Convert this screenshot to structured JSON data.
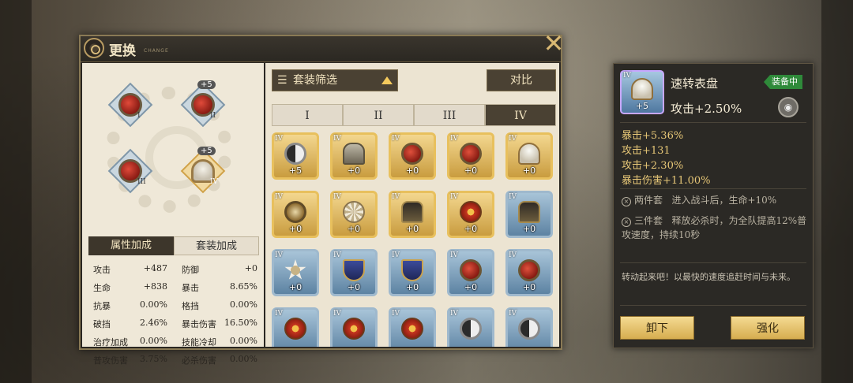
{
  "panel": {
    "title": "更换",
    "subtitle": "CHANGE",
    "close_label": "✕"
  },
  "equipped_slots": [
    {
      "roman": "I",
      "plus": "",
      "kind": "red"
    },
    {
      "roman": "II",
      "plus": "+5",
      "kind": "red"
    },
    {
      "roman": "III",
      "plus": "",
      "kind": "red"
    },
    {
      "roman": "IV",
      "plus": "+5",
      "kind": "gauge"
    }
  ],
  "stat_tabs": {
    "active": "属性加成",
    "inactive": "套装加成"
  },
  "stats": [
    {
      "k1": "攻击",
      "v1": "+487",
      "k2": "防御",
      "v2": "+0"
    },
    {
      "k1": "生命",
      "v1": "+838",
      "k2": "暴击",
      "v2": "8.65%"
    },
    {
      "k1": "抗暴",
      "v1": "0.00%",
      "k2": "格挡",
      "v2": "0.00%"
    },
    {
      "k1": "破挡",
      "v1": "2.46%",
      "k2": "暴击伤害",
      "v2": "16.50%"
    },
    {
      "k1": "治疗加成",
      "v1": "0.00%",
      "k2": "技能冷却",
      "v2": "0.00%"
    },
    {
      "k1": "普攻伤害",
      "v1": "3.75%",
      "k2": "必杀伤害",
      "v2": "0.00%"
    }
  ],
  "toolbar": {
    "filter_icon": "☰",
    "filter_label": "套装筛选",
    "compare_label": "对比"
  },
  "slot_tabs": [
    "I",
    "II",
    "III",
    "IV"
  ],
  "slot_tab_active": "IV",
  "items": [
    {
      "rarity": "gold",
      "roman": "IV",
      "level": "+5",
      "icon": "yin"
    },
    {
      "rarity": "gold",
      "roman": "IV",
      "level": "+0",
      "icon": "helm"
    },
    {
      "rarity": "gold",
      "roman": "IV",
      "level": "+0",
      "icon": "red"
    },
    {
      "rarity": "gold",
      "roman": "IV",
      "level": "+0",
      "icon": "red"
    },
    {
      "rarity": "gold",
      "roman": "IV",
      "level": "+0",
      "icon": "gauge"
    },
    {
      "rarity": "gold",
      "roman": "IV",
      "level": "+0",
      "icon": "watch"
    },
    {
      "rarity": "gold",
      "roman": "IV",
      "level": "+0",
      "icon": "shell"
    },
    {
      "rarity": "gold",
      "roman": "IV",
      "level": "+0",
      "icon": "anubis"
    },
    {
      "rarity": "gold",
      "roman": "IV",
      "level": "+0",
      "icon": "flower"
    },
    {
      "rarity": "blue",
      "roman": "IV",
      "level": "+0",
      "icon": "anubis"
    },
    {
      "rarity": "blue",
      "roman": "IV",
      "level": "+0",
      "icon": "star"
    },
    {
      "rarity": "blue",
      "roman": "IV",
      "level": "+0",
      "icon": "shield"
    },
    {
      "rarity": "blue",
      "roman": "IV",
      "level": "+0",
      "icon": "shield"
    },
    {
      "rarity": "blue",
      "roman": "IV",
      "level": "+0",
      "icon": "red"
    },
    {
      "rarity": "blue",
      "roman": "IV",
      "level": "+0",
      "icon": "red"
    },
    {
      "rarity": "blue",
      "roman": "IV",
      "level": "",
      "icon": "flower"
    },
    {
      "rarity": "blue",
      "roman": "IV",
      "level": "",
      "icon": "flower"
    },
    {
      "rarity": "blue",
      "roman": "IV",
      "level": "",
      "icon": "flower"
    },
    {
      "rarity": "blue",
      "roman": "IV",
      "level": "",
      "icon": "yin"
    },
    {
      "rarity": "blue",
      "roman": "IV",
      "level": "",
      "icon": "yin"
    }
  ],
  "detail": {
    "roman": "IV",
    "level": "+5",
    "name": "速转表盘",
    "badge": "装备中",
    "main_stat": "攻击+2.50%",
    "lock_icon": "lock-icon",
    "sub_stats": [
      "暴击+5.36%",
      "攻击+131",
      "攻击+2.30%",
      "暴击伤害+11.00%"
    ],
    "set2_label": "两件套",
    "set2_text": "进入战斗后，生命+10%",
    "set3_label": "三件套",
    "set3_text": "释放必杀时，为全队提高12%普攻速度，持续10秒",
    "flavor": "转动起来吧！以最快的速度追赶时间与未来。",
    "unequip_label": "卸下",
    "enhance_label": "强化"
  },
  "colors": {
    "gold_frame": "#e8c05d",
    "blue_frame": "#9fb9cd",
    "equipped_badge": "#2f8a3a",
    "substat_text": "#e7c777"
  }
}
